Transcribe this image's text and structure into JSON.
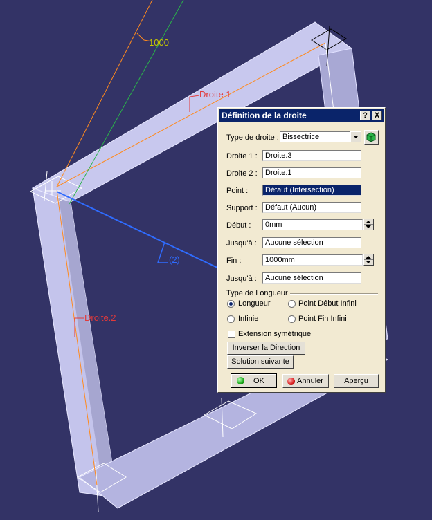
{
  "viewport": {
    "labels": {
      "droite1": "Droite.1",
      "droite2": "Droite.2",
      "dim_1000": "1000",
      "angle_2": "(2)"
    },
    "colors": {
      "background": "#333366",
      "frame_face": "#c8c8ee",
      "frame_side": "#9a9ac4",
      "line_orange": "#ff8a1e",
      "line_green": "#2ab44a",
      "line_blue": "#2f6cff",
      "label_red": "#e23a3a"
    }
  },
  "dialog": {
    "title": "Définition de la droite",
    "help_label": "?",
    "close_label": "X",
    "type_label": "Type de droite :",
    "type_value": "Bissectrice",
    "droite1_label": "Droite 1 :",
    "droite1_value": "Droite.3",
    "droite2_label": "Droite 2 :",
    "droite2_value": "Droite.1",
    "point_label": "Point :",
    "point_value": "Défaut (Intersection)",
    "support_label": "Support :",
    "support_value": "Défaut (Aucun)",
    "debut_label": "Début :",
    "debut_value": "0mm",
    "jusqua1_label": "Jusqu'à :",
    "jusqua1_value": "Aucune sélection",
    "fin_label": "Fin :",
    "fin_value": "1000mm",
    "jusqua2_label": "Jusqu'à :",
    "jusqua2_value": "Aucune sélection",
    "length_group": "Type de Longueur",
    "opt_longueur": "Longueur",
    "opt_point_debut": "Point Début Infini",
    "opt_infinie": "Infinie",
    "opt_point_fin": "Point Fin Infini",
    "selected_length_option": "Longueur",
    "extension_label": "Extension symétrique",
    "inverser_label": "Inverser la Direction",
    "solution_label": "Solution suivante",
    "ok_label": "OK",
    "annuler_label": "Annuler",
    "apercu_label": "Aperçu"
  }
}
